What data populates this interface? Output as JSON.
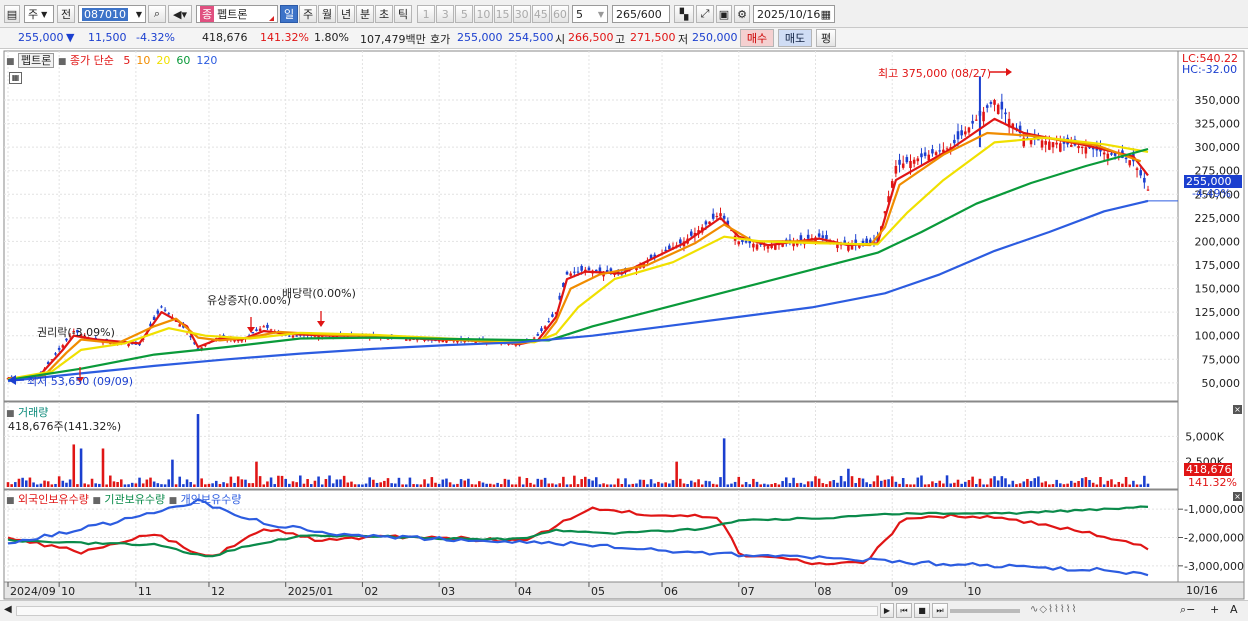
{
  "toolbar": {
    "mode": "주",
    "prefix": "전",
    "code": "087010",
    "kind_badge": "종",
    "stock_name": "펩트론",
    "periods": [
      "일",
      "주",
      "월",
      "년",
      "분",
      "초",
      "틱"
    ],
    "period_selected": "일",
    "minute_opts": [
      "1",
      "3",
      "5",
      "10",
      "15",
      "30",
      "45",
      "60"
    ],
    "minute_value": "5",
    "count": "265",
    "count_total": "/600",
    "date": "2025/10/16"
  },
  "info": {
    "price": "255,000",
    "change": "11,500",
    "change_pct": "-4.32%",
    "volume": "418,676",
    "vol_ratio": "141.32%",
    "turnover_pct": "1.80%",
    "amount": "107,479백만",
    "quote_label": "호가",
    "ask": "255,000",
    "bid": "254,500",
    "open_label": "시",
    "open": "266,500",
    "high_label": "고",
    "high": "271,500",
    "low_label": "저",
    "low": "250,000",
    "buy": "매수",
    "sell": "매도",
    "avg": "평"
  },
  "price_pane": {
    "stock_label": "펩트론",
    "ma_title": "종가 단순",
    "ma_periods": [
      "5",
      "10",
      "20",
      "60",
      "120"
    ],
    "ma_colors": [
      "#e01515",
      "#f08c00",
      "#f0e000",
      "#0a9a3a",
      "#2c5ce0"
    ],
    "lc": "LC:540.22",
    "hc": "HC:-32.00",
    "current_tag": "255,000",
    "current_pct": "-4.49%",
    "high_note": "최고 375,000 (08/27)",
    "low_note": "최저 53,650 (09/09)",
    "events": [
      "권리락(-3.09%)",
      "유상증자(0.00%)",
      "배당락(0.00%)"
    ]
  },
  "volume_pane": {
    "title": "거래량",
    "value": "418,676주(141.32%)",
    "tag": "418,676",
    "tag_pct": "141.32%"
  },
  "holdings_pane": {
    "titles": [
      "외국인보유수량",
      "기관보유수량",
      "개인보유수량"
    ],
    "colors": [
      "#e01515",
      "#0a8a4a",
      "#2c5ce0"
    ]
  },
  "x_axis": {
    "end_label": "10/16"
  },
  "chart_data": [
    {
      "type": "candlestick",
      "title": "",
      "y_ticks": [
        50000,
        75000,
        100000,
        125000,
        150000,
        175000,
        200000,
        225000,
        250000,
        275000,
        300000,
        325000,
        350000
      ],
      "y_tick_labels": [
        "50,000",
        "75,000",
        "100,000",
        "125,000",
        "150,000",
        "175,000",
        "200,000",
        "225,000",
        "250,000",
        "275,000",
        "300,000",
        "325,000",
        "350,000"
      ],
      "x_labels": [
        "2024/09",
        "10",
        "11",
        "12",
        "2025/01",
        "02",
        "03",
        "04",
        "05",
        "06",
        "07",
        "08",
        "09",
        "10"
      ],
      "close_path": [
        [
          0,
          55000
        ],
        [
          8,
          55000
        ],
        [
          15,
          90000
        ],
        [
          18,
          105000
        ],
        [
          24,
          95000
        ],
        [
          36,
          90000
        ],
        [
          42,
          130000
        ],
        [
          49,
          105000
        ],
        [
          52,
          85000
        ],
        [
          58,
          100000
        ],
        [
          64,
          95000
        ],
        [
          70,
          110000
        ],
        [
          76,
          100000
        ],
        [
          88,
          100000
        ],
        [
          100,
          100000
        ],
        [
          116,
          95000
        ],
        [
          130,
          95000
        ],
        [
          140,
          90000
        ],
        [
          145,
          100000
        ],
        [
          150,
          125000
        ],
        [
          153,
          165000
        ],
        [
          158,
          170000
        ],
        [
          168,
          165000
        ],
        [
          185,
          200000
        ],
        [
          195,
          230000
        ],
        [
          200,
          200000
        ],
        [
          208,
          195000
        ],
        [
          222,
          205000
        ],
        [
          230,
          195000
        ],
        [
          238,
          200000
        ],
        [
          243,
          280000
        ],
        [
          258,
          300000
        ],
        [
          270,
          350000
        ],
        [
          278,
          310000
        ],
        [
          295,
          300000
        ],
        [
          308,
          285000
        ],
        [
          312,
          255000
        ]
      ],
      "ma_paths": [
        {
          "name": "5",
          "values": [
            [
              0,
              55000
            ],
            [
              8,
              55000
            ],
            [
              15,
              85000
            ],
            [
              18,
              100000
            ],
            [
              24,
              96000
            ],
            [
              36,
              92000
            ],
            [
              42,
              125000
            ],
            [
              49,
              110000
            ],
            [
              52,
              88000
            ],
            [
              58,
              97000
            ],
            [
              64,
              96000
            ],
            [
              70,
              105000
            ],
            [
              76,
              102000
            ],
            [
              88,
              100000
            ],
            [
              100,
              100000
            ],
            [
              116,
              96000
            ],
            [
              130,
              95000
            ],
            [
              140,
              91000
            ],
            [
              145,
              95000
            ],
            [
              150,
              120000
            ],
            [
              153,
              160000
            ],
            [
              158,
              168000
            ],
            [
              168,
              166000
            ],
            [
              185,
              198000
            ],
            [
              195,
              225000
            ],
            [
              200,
              205000
            ],
            [
              208,
              196000
            ],
            [
              222,
              203000
            ],
            [
              230,
              196000
            ],
            [
              238,
              198000
            ],
            [
              243,
              265000
            ],
            [
              258,
              298000
            ],
            [
              270,
              330000
            ],
            [
              278,
              315000
            ],
            [
              295,
              302000
            ],
            [
              308,
              290000
            ],
            [
              312,
              270000
            ]
          ]
        },
        {
          "name": "10",
          "values": [
            [
              0,
              54000
            ],
            [
              10,
              58000
            ],
            [
              16,
              82000
            ],
            [
              20,
              96000
            ],
            [
              30,
              92000
            ],
            [
              40,
              110000
            ],
            [
              46,
              118000
            ],
            [
              52,
              98000
            ],
            [
              58,
              95000
            ],
            [
              66,
              98000
            ],
            [
              74,
              104000
            ],
            [
              88,
              101000
            ],
            [
              100,
              100000
            ],
            [
              116,
              97000
            ],
            [
              140,
              92000
            ],
            [
              146,
              95000
            ],
            [
              150,
              115000
            ],
            [
              154,
              150000
            ],
            [
              162,
              165000
            ],
            [
              175,
              175000
            ],
            [
              188,
              198000
            ],
            [
              196,
              218000
            ],
            [
              204,
              200000
            ],
            [
              218,
              200000
            ],
            [
              236,
              196000
            ],
            [
              240,
              215000
            ],
            [
              244,
              260000
            ],
            [
              256,
              292000
            ],
            [
              268,
              315000
            ],
            [
              280,
              312000
            ],
            [
              298,
              302000
            ],
            [
              310,
              285000
            ]
          ]
        },
        {
          "name": "20",
          "values": [
            [
              0,
              54000
            ],
            [
              12,
              62000
            ],
            [
              20,
              85000
            ],
            [
              32,
              92000
            ],
            [
              44,
              108000
            ],
            [
              54,
              100000
            ],
            [
              66,
              97000
            ],
            [
              80,
              103000
            ],
            [
              100,
              101000
            ],
            [
              120,
              97000
            ],
            [
              144,
              93000
            ],
            [
              150,
              102000
            ],
            [
              156,
              130000
            ],
            [
              166,
              160000
            ],
            [
              182,
              178000
            ],
            [
              196,
              205000
            ],
            [
              206,
              200000
            ],
            [
              222,
              198000
            ],
            [
              238,
              197000
            ],
            [
              246,
              230000
            ],
            [
              256,
              265000
            ],
            [
              270,
              305000
            ],
            [
              284,
              310000
            ],
            [
              300,
              303000
            ],
            [
              312,
              295000
            ]
          ]
        },
        {
          "name": "60",
          "values": [
            [
              0,
              53000
            ],
            [
              20,
              65000
            ],
            [
              40,
              80000
            ],
            [
              60,
              88000
            ],
            [
              80,
              97000
            ],
            [
              100,
              98000
            ],
            [
              130,
              96000
            ],
            [
              148,
              95000
            ],
            [
              160,
              110000
            ],
            [
              180,
              130000
            ],
            [
              200,
              150000
            ],
            [
              220,
              170000
            ],
            [
              238,
              188000
            ],
            [
              250,
              210000
            ],
            [
              265,
              240000
            ],
            [
              280,
              262000
            ],
            [
              295,
              280000
            ],
            [
              312,
              298000
            ]
          ]
        },
        {
          "name": "120",
          "values": [
            [
              0,
              52000
            ],
            [
              20,
              60000
            ],
            [
              40,
              68000
            ],
            [
              60,
              75000
            ],
            [
              80,
              81000
            ],
            [
              100,
              86000
            ],
            [
              120,
              90000
            ],
            [
              140,
              93000
            ],
            [
              160,
              100000
            ],
            [
              180,
              110000
            ],
            [
              200,
              120000
            ],
            [
              220,
              130000
            ],
            [
              240,
              145000
            ],
            [
              255,
              165000
            ],
            [
              270,
              190000
            ],
            [
              285,
              210000
            ],
            [
              300,
              232000
            ],
            [
              312,
              243000
            ]
          ]
        }
      ],
      "high": {
        "label": "최고 375,000 (08/27)",
        "value": 375000
      },
      "low": {
        "label": "최저 53,650 (09/09)",
        "value": 53650
      }
    },
    {
      "type": "bar",
      "title": "거래량",
      "y_ticks": [
        2500000,
        5000000
      ],
      "y_tick_labels": [
        "2,500K",
        "5,000K"
      ],
      "spikes": [
        [
          18,
          4200000
        ],
        [
          20,
          3800000
        ],
        [
          26,
          3800000
        ],
        [
          45,
          2700000
        ],
        [
          52,
          7200000
        ],
        [
          68,
          2500000
        ],
        [
          183,
          2500000
        ],
        [
          196,
          4800000
        ],
        [
          230,
          1800000
        ]
      ]
    },
    {
      "type": "line",
      "title": "외국인보유수량 / 기관보유수량 / 개인보유수량",
      "y_ticks": [
        -1000000,
        -2000000,
        -3000000
      ],
      "y_tick_labels": [
        "-1,000,000",
        "-2,000,000",
        "-3,000,000"
      ],
      "series": [
        {
          "name": "외국인보유수량",
          "values": [
            [
              0,
              -1950000
            ],
            [
              10,
              -2300000
            ],
            [
              20,
              -2500000
            ],
            [
              40,
              -1850000
            ],
            [
              55,
              -2750000
            ],
            [
              70,
              -1650000
            ],
            [
              85,
              -2100000
            ],
            [
              100,
              -1950000
            ],
            [
              120,
              -2000000
            ],
            [
              140,
              -2150000
            ],
            [
              150,
              -1600000
            ],
            [
              160,
              -950000
            ],
            [
              175,
              -1200000
            ],
            [
              195,
              -1300000
            ],
            [
              200,
              -2600000
            ],
            [
              220,
              -2900000
            ],
            [
              235,
              -2850000
            ],
            [
              245,
              -1400000
            ],
            [
              260,
              -1200000
            ],
            [
              280,
              -1450000
            ],
            [
              300,
              -1950000
            ],
            [
              312,
              -2400000
            ]
          ]
        },
        {
          "name": "기관보유수량",
          "values": [
            [
              0,
              -2100000
            ],
            [
              20,
              -2200000
            ],
            [
              40,
              -2250000
            ],
            [
              55,
              -2700000
            ],
            [
              65,
              -2300000
            ],
            [
              80,
              -1950000
            ],
            [
              100,
              -1950000
            ],
            [
              120,
              -2050000
            ],
            [
              140,
              -2050000
            ],
            [
              150,
              -1750000
            ],
            [
              165,
              -1850000
            ],
            [
              190,
              -1700000
            ],
            [
              200,
              -1400000
            ],
            [
              225,
              -1300000
            ],
            [
              245,
              -1150000
            ],
            [
              275,
              -1150000
            ],
            [
              300,
              -1000000
            ],
            [
              312,
              -900000
            ]
          ]
        },
        {
          "name": "개인보유수량",
          "values": [
            [
              0,
              -2200000
            ],
            [
              20,
              -1700000
            ],
            [
              40,
              -1150000
            ],
            [
              52,
              -700000
            ],
            [
              70,
              -1500000
            ],
            [
              90,
              -1900000
            ],
            [
              110,
              -2000000
            ],
            [
              130,
              -2100000
            ],
            [
              150,
              -2200000
            ],
            [
              165,
              -2300000
            ],
            [
              185,
              -2500000
            ],
            [
              200,
              -2600000
            ],
            [
              220,
              -2700000
            ],
            [
              250,
              -2900000
            ],
            [
              280,
              -3050000
            ],
            [
              300,
              -3150000
            ],
            [
              312,
              -3300000
            ]
          ]
        }
      ]
    }
  ]
}
